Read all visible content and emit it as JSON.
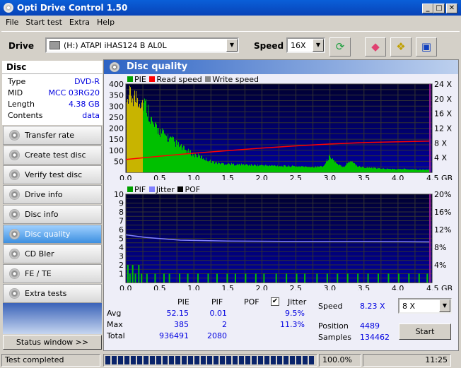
{
  "window": {
    "title": "Opti Drive Control 1.50",
    "min": "_",
    "max": "□",
    "close": "✕"
  },
  "menu": [
    "File",
    "Start test",
    "Extra",
    "Help"
  ],
  "toolbar": {
    "drive_label": "Drive",
    "drive_value": "(H:)  ATAPI iHAS124   B AL0L",
    "speed_label": "Speed",
    "speed_value": "16X",
    "icons": [
      "refresh-icon",
      "eraser-icon",
      "copy-icon",
      "save-icon"
    ]
  },
  "disc": {
    "header": "Disc",
    "rows": [
      {
        "k": "Type",
        "v": "DVD-R"
      },
      {
        "k": "MID",
        "v": "MCC 03RG20"
      },
      {
        "k": "Length",
        "v": "4.38 GB"
      },
      {
        "k": "Contents",
        "v": "data"
      }
    ]
  },
  "nav": [
    {
      "label": "Transfer rate"
    },
    {
      "label": "Create test disc"
    },
    {
      "label": "Verify test disc"
    },
    {
      "label": "Drive info"
    },
    {
      "label": "Disc info"
    },
    {
      "label": "Disc quality",
      "active": true
    },
    {
      "label": "CD Bler"
    },
    {
      "label": "FE / TE"
    },
    {
      "label": "Extra tests"
    }
  ],
  "status_window": "Status window >>",
  "panel_title": "Disc quality",
  "chart_data": [
    {
      "type": "bar",
      "legend": [
        "PIE",
        "Read speed",
        "Write speed"
      ],
      "colors": {
        "PIE": "#00c000",
        "Read speed": "#ff0000",
        "Write speed": "#808080",
        "highlight": "#c8b400",
        "bg": "#000060",
        "end": "#a020a0"
      },
      "x_ticks": [
        "0.0",
        "0.5",
        "1.0",
        "1.5",
        "2.0",
        "2.5",
        "3.0",
        "3.5",
        "4.0",
        "4.5 GB"
      ],
      "xlim": [
        0,
        4.5
      ],
      "y_ticks": [
        "50",
        "100",
        "150",
        "200",
        "250",
        "300",
        "350",
        "400"
      ],
      "ylim": [
        0,
        400
      ],
      "y2_ticks": [
        "4 X",
        "8 X",
        "12 X",
        "16 X",
        "20 X",
        "24 X"
      ],
      "y2lim": [
        0,
        24
      ],
      "pie_x_step": 0.1,
      "pie": [
        340,
        345,
        330,
        300,
        210,
        185,
        160,
        140,
        115,
        95,
        80,
        70,
        55,
        45,
        40,
        38,
        36,
        35,
        34,
        32,
        32,
        30,
        30,
        28,
        28,
        27,
        26,
        25,
        25,
        28,
        75,
        35,
        26,
        55,
        28,
        22,
        20,
        18,
        16,
        15,
        14,
        16,
        14,
        12,
        12
      ],
      "highlight_range": [
        0,
        0.24
      ],
      "end_marker": 4.47,
      "read_speed": [
        [
          0,
          3.5
        ],
        [
          0.5,
          4.4
        ],
        [
          1.0,
          5.2
        ],
        [
          1.5,
          5.9
        ],
        [
          2.0,
          6.6
        ],
        [
          2.5,
          7.2
        ],
        [
          3.0,
          7.7
        ],
        [
          3.5,
          8.1
        ],
        [
          4.0,
          8.3
        ],
        [
          4.47,
          8.5
        ]
      ]
    },
    {
      "type": "bar",
      "legend": [
        "PIF",
        "Jitter",
        "POF"
      ],
      "colors": {
        "PIF": "#00c000",
        "Jitter": "#8080ff",
        "POF": "#000000",
        "bg": "#000060"
      },
      "x_ticks": [
        "0.0",
        "0.5",
        "1.0",
        "1.5",
        "2.0",
        "2.5",
        "3.0",
        "3.5",
        "4.0",
        "4.5 GB"
      ],
      "xlim": [
        0,
        4.5
      ],
      "y_ticks": [
        "1",
        "2",
        "3",
        "4",
        "5",
        "6",
        "7",
        "8",
        "9",
        "10"
      ],
      "ylim": [
        0,
        10
      ],
      "y2_ticks": [
        "4%",
        "8%",
        "12%",
        "16%",
        "20%"
      ],
      "y2lim": [
        0,
        20
      ],
      "pif": [
        [
          0.02,
          2
        ],
        [
          0.05,
          1
        ],
        [
          0.09,
          2
        ],
        [
          0.13,
          1
        ],
        [
          0.18,
          2
        ],
        [
          0.22,
          1
        ],
        [
          0.3,
          1
        ],
        [
          0.42,
          1
        ],
        [
          0.55,
          1
        ],
        [
          0.63,
          1
        ],
        [
          0.78,
          1
        ],
        [
          0.9,
          1
        ],
        [
          1.05,
          1
        ],
        [
          1.2,
          1
        ],
        [
          1.33,
          1
        ],
        [
          1.48,
          1
        ],
        [
          1.6,
          1
        ],
        [
          1.75,
          1
        ],
        [
          1.9,
          1
        ],
        [
          2.02,
          1
        ],
        [
          2.2,
          1
        ],
        [
          2.35,
          1
        ],
        [
          2.5,
          1
        ],
        [
          2.62,
          1
        ],
        [
          2.8,
          1
        ],
        [
          2.95,
          1
        ],
        [
          3.1,
          1
        ],
        [
          3.25,
          1
        ],
        [
          3.4,
          1
        ],
        [
          3.55,
          1
        ],
        [
          3.7,
          1
        ],
        [
          3.85,
          1
        ],
        [
          4.0,
          1
        ],
        [
          4.15,
          1
        ],
        [
          4.3,
          1
        ],
        [
          4.42,
          1
        ]
      ],
      "jitter": [
        [
          0,
          10.8
        ],
        [
          0.3,
          10.2
        ],
        [
          0.8,
          9.6
        ],
        [
          1.5,
          9.4
        ],
        [
          2.5,
          9.3
        ],
        [
          3.5,
          9.3
        ],
        [
          4.47,
          9.2
        ]
      ]
    }
  ],
  "stats": {
    "cols": [
      "PIE",
      "PIF",
      "POF",
      "Jitter"
    ],
    "rows": [
      {
        "label": "Avg",
        "pie": "52.15",
        "pif": "0.01",
        "jitter": "9.5%"
      },
      {
        "label": "Max",
        "pie": "385",
        "pif": "2",
        "jitter": "11.3%"
      },
      {
        "label": "Total",
        "pie": "936491",
        "pif": "2080"
      }
    ],
    "jitter_checked": true,
    "speed_label": "Speed",
    "speed_value": "8.23 X",
    "position_label": "Position",
    "position_value": "4489",
    "samples_label": "Samples",
    "samples_value": "134462",
    "speed_select": "8 X",
    "start": "Start"
  },
  "statusbar": {
    "text": "Test completed",
    "progress": 100,
    "percent": "100.0%",
    "time": "11:25"
  }
}
